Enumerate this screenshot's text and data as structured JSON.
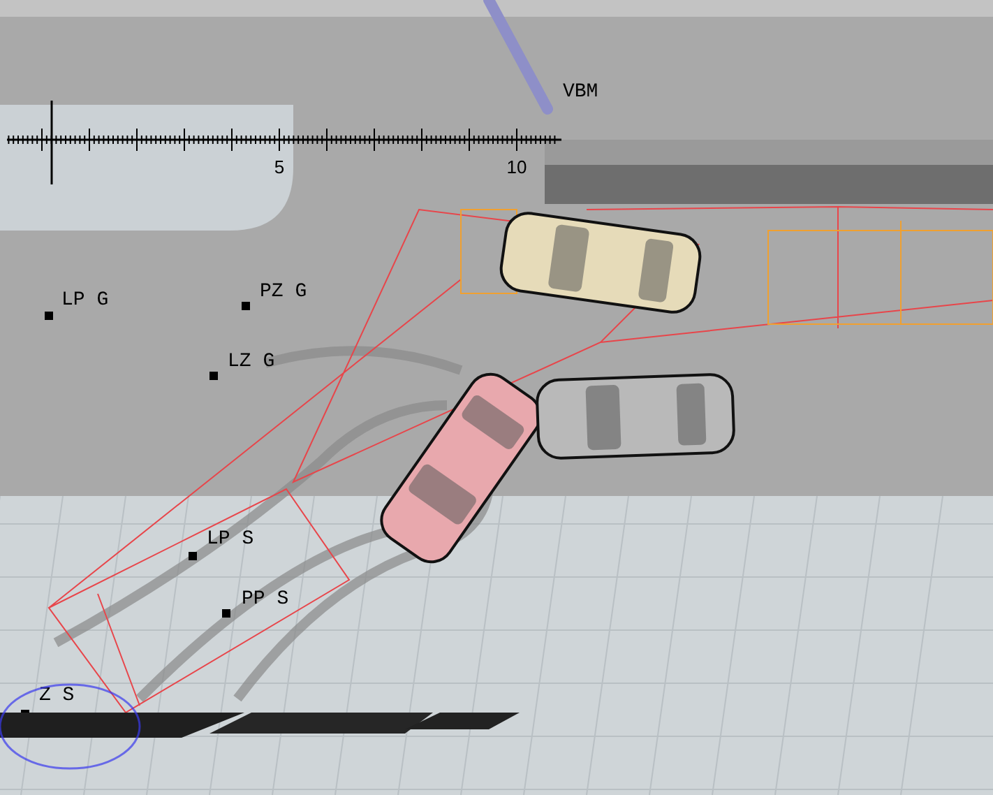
{
  "viewport": {
    "camera": {
      "label": "VBM"
    },
    "scale": {
      "ticks": [
        "5",
        "10"
      ]
    },
    "points": [
      {
        "label": "LP G"
      },
      {
        "label": "PZ G"
      },
      {
        "label": "LZ G"
      },
      {
        "label": "LP S"
      },
      {
        "label": "PP S"
      },
      {
        "label": "Z S"
      }
    ],
    "vehicles": [
      {
        "color": "#e6dbb9"
      },
      {
        "color": "#e8a8ad"
      },
      {
        "color": "#b9b9b9"
      }
    ]
  }
}
